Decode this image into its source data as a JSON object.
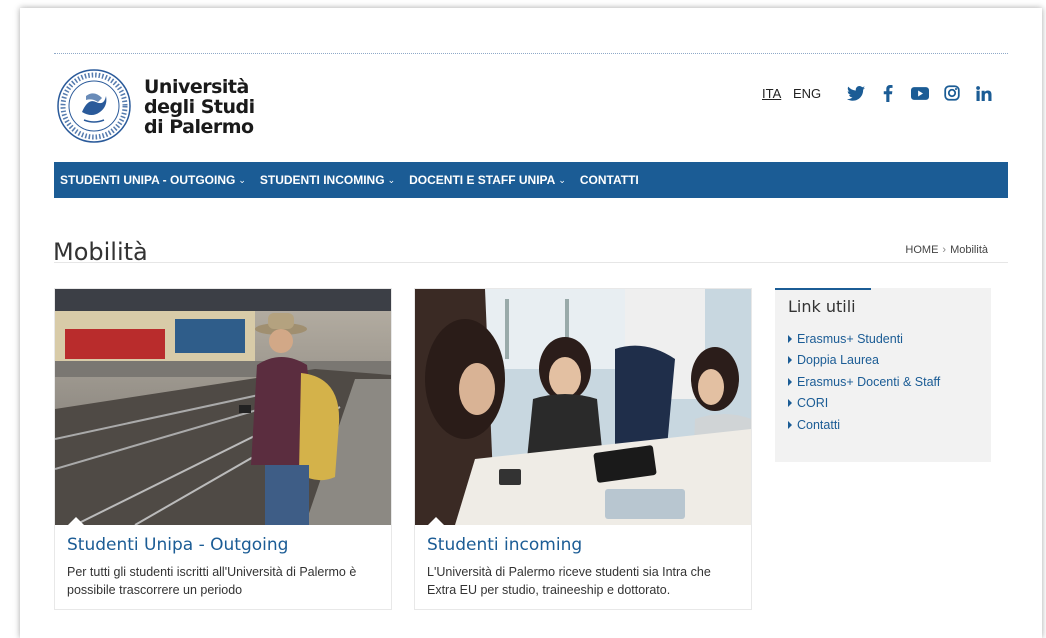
{
  "header": {
    "logo_lines": [
      "Università",
      "degli Studi",
      "di Palermo"
    ],
    "seal_text": "PANORMITANÆ STVDIORVM VNIVERSITAS SIGILLVM",
    "lang_ita": "ITA",
    "lang_eng": "ENG",
    "social_icons": [
      "twitter-icon",
      "facebook-icon",
      "youtube-icon",
      "instagram-icon",
      "linkedin-icon"
    ]
  },
  "nav": {
    "items": [
      {
        "label": "STUDENTI UNIPA - OUTGOING",
        "dropdown": true
      },
      {
        "label": "STUDENTI INCOMING",
        "dropdown": true
      },
      {
        "label": "DOCENTI E STAFF UNIPA",
        "dropdown": true
      },
      {
        "label": "CONTATTI",
        "dropdown": false
      }
    ]
  },
  "page": {
    "title": "Mobilità",
    "breadcrumb": {
      "home": "HOME",
      "sep": "›",
      "current": "Mobilità"
    }
  },
  "cards": [
    {
      "title": "Studenti Unipa - Outgoing",
      "text": "Per tutti gli studenti iscritti all'Università di Palermo è possibile trascorrere un periodo"
    },
    {
      "title": "Studenti incoming",
      "text": "L'Università di Palermo riceve studenti sia Intra che Extra EU per studio, traineeship e dottorato."
    }
  ],
  "sidebar": {
    "title": "Link utili",
    "links": [
      "Erasmus+ Studenti",
      "Doppia Laurea",
      "Erasmus+ Docenti & Staff",
      "CORI",
      "Contatti"
    ]
  },
  "colors": {
    "brand_blue": "#1b5c95",
    "sidebar_bg": "#f2f2f2"
  }
}
